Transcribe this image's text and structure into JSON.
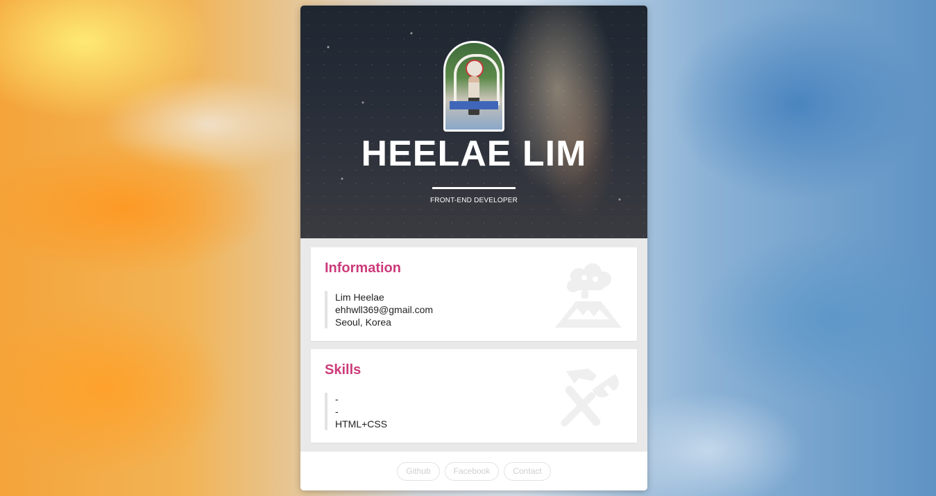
{
  "profile": {
    "name": "HEELAE LIM",
    "role": "FRONT-END DEVELOPER"
  },
  "information": {
    "title": "Information",
    "items": [
      "Lim Heelae",
      "ehhwll369@gmail.com",
      "Seoul, Korea"
    ],
    "icon": "volcano-icon"
  },
  "skills": {
    "title": "Skills",
    "items": [
      "-",
      "-",
      "HTML+CSS"
    ],
    "icon": "tools-icon"
  },
  "footer": {
    "links": [
      "Github",
      "Facebook",
      "Contact"
    ]
  },
  "colors": {
    "accent": "#cc3a7a",
    "card_bg": "#e9e9e9",
    "section_bg": "#ffffff",
    "footer_text": "#cfcfcf"
  }
}
